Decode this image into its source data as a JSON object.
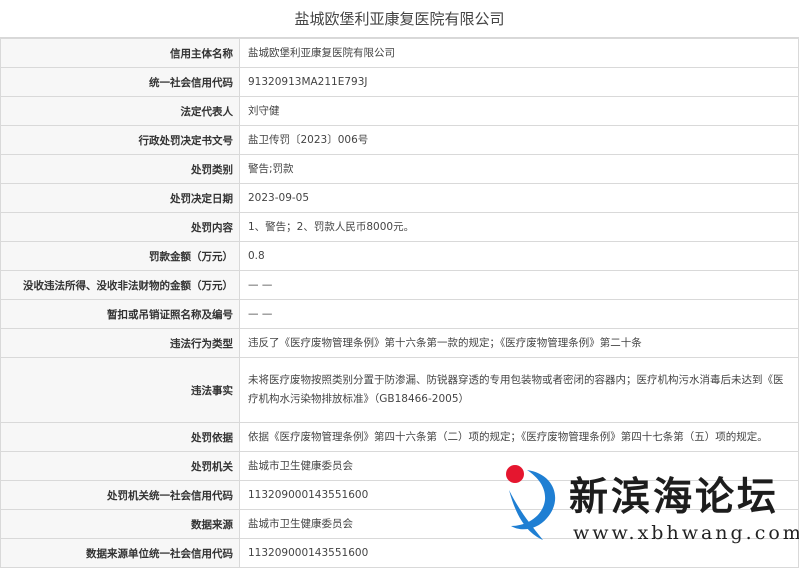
{
  "page": {
    "title": "盐城欧堡利亚康复医院有限公司"
  },
  "rows": [
    {
      "label": "信用主体名称",
      "value": "盐城欧堡利亚康复医院有限公司"
    },
    {
      "label": "统一社会信用代码",
      "value": "91320913MA211E793J"
    },
    {
      "label": "法定代表人",
      "value": "刘守健"
    },
    {
      "label": "行政处罚决定书文号",
      "value": "盐卫传罚〔2023〕006号"
    },
    {
      "label": "处罚类别",
      "value": "警告;罚款"
    },
    {
      "label": "处罚决定日期",
      "value": "2023-09-05"
    },
    {
      "label": "处罚内容",
      "value": "1、警告；2、罚款人民币8000元。"
    },
    {
      "label": "罚款金额（万元）",
      "value": "0.8"
    },
    {
      "label": "没收违法所得、没收非法财物的金额（万元）",
      "value": "— —"
    },
    {
      "label": "暂扣或吊销证照名称及编号",
      "value": "— —"
    },
    {
      "label": "违法行为类型",
      "value": "违反了《医疗废物管理条例》第十六条第一款的规定；《医疗废物管理条例》第二十条"
    },
    {
      "label": "违法事实",
      "value": "未将医疗废物按照类别分置于防渗漏、防锐器穿透的专用包装物或者密闭的容器内；医疗机构污水消毒后未达到《医疗机构水污染物排放标准》（GB18466-2005）"
    },
    {
      "label": "处罚依据",
      "value": "依据《医疗废物管理条例》第四十六条第（二）项的规定；《医疗废物管理条例》第四十七条第（五）项的规定。"
    },
    {
      "label": "处罚机关",
      "value": "盐城市卫生健康委员会"
    },
    {
      "label": "处罚机关统一社会信用代码",
      "value": "11320900014355160​0"
    },
    {
      "label": "数据来源",
      "value": "盐城市卫生健康委员会"
    },
    {
      "label": "数据来源单位统一社会信用代码",
      "value": "11320900014355160​0"
    }
  ],
  "watermark": {
    "name": "新滨海论坛",
    "url": "www.xbhwang.com",
    "logo_icon": "xbh-swirl-logo-icon",
    "colors": {
      "red": "#e5162f",
      "blue": "#1f7fd3",
      "text": "#1d1d1d"
    }
  }
}
